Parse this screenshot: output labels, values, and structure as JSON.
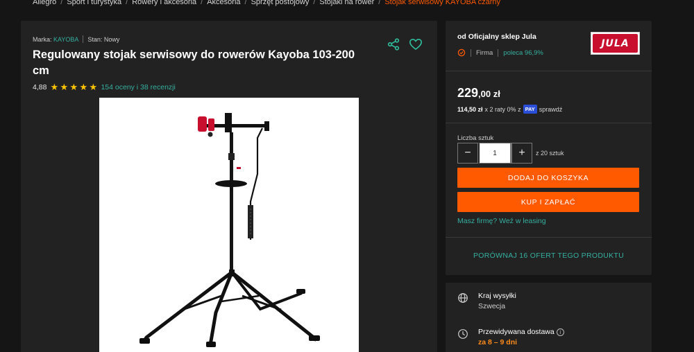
{
  "breadcrumbs": {
    "items": [
      "Allegro",
      "Sport i turystyka",
      "Rowery i akcesoria",
      "Akcesoria",
      "Sprzęt postojowy",
      "Stojaki na rower"
    ],
    "current": "Stojak serwisowy KAYOBA czarny"
  },
  "product": {
    "brand_label": "Marka:",
    "brand": "KAYOBA",
    "condition_label": "Stan:",
    "condition": "Nowy",
    "title": "Regulowany stojak serwisowy do rowerów Kayoba 103-200 cm",
    "rating": "4,88",
    "stars": 5,
    "reviews_link": "154 oceny i 38 recenzji",
    "image_alt": "Stojak serwisowy rowerowy"
  },
  "seller": {
    "name": "od Oficjalny sklep Jula",
    "type": "Firma",
    "recommend": "poleca 96,9%",
    "logo_text": "JULA"
  },
  "offer": {
    "price_main": "229",
    "price_cents": ",00 zł",
    "installment_amount": "114,50 zł",
    "installment_text": "x 2 raty 0% z",
    "pay_badge": "PAY",
    "check_text": "sprawdź",
    "qty_label": "Liczba sztuk",
    "qty_value": "1",
    "qty_minus": "−",
    "qty_plus": "+",
    "qty_note": "z 20 sztuk",
    "add_to_cart": "DODAJ DO KOSZYKA",
    "buy_now": "KUP I ZAPŁAĆ",
    "leasing": "Masz firmę? Weź w leasing",
    "compare": "PORÓWNAJ 16 OFERT TEGO PRODUKTU"
  },
  "shipping": {
    "country_label": "Kraj wysyłki",
    "country": "Szwecja",
    "delivery_label": "Przewidywana dostawa",
    "delivery": "za 8 – 9 dni",
    "info": "i"
  },
  "colors": {
    "accent": "#ff5a00",
    "link": "#35b0a0",
    "panel": "#222222",
    "background": "#151515"
  }
}
